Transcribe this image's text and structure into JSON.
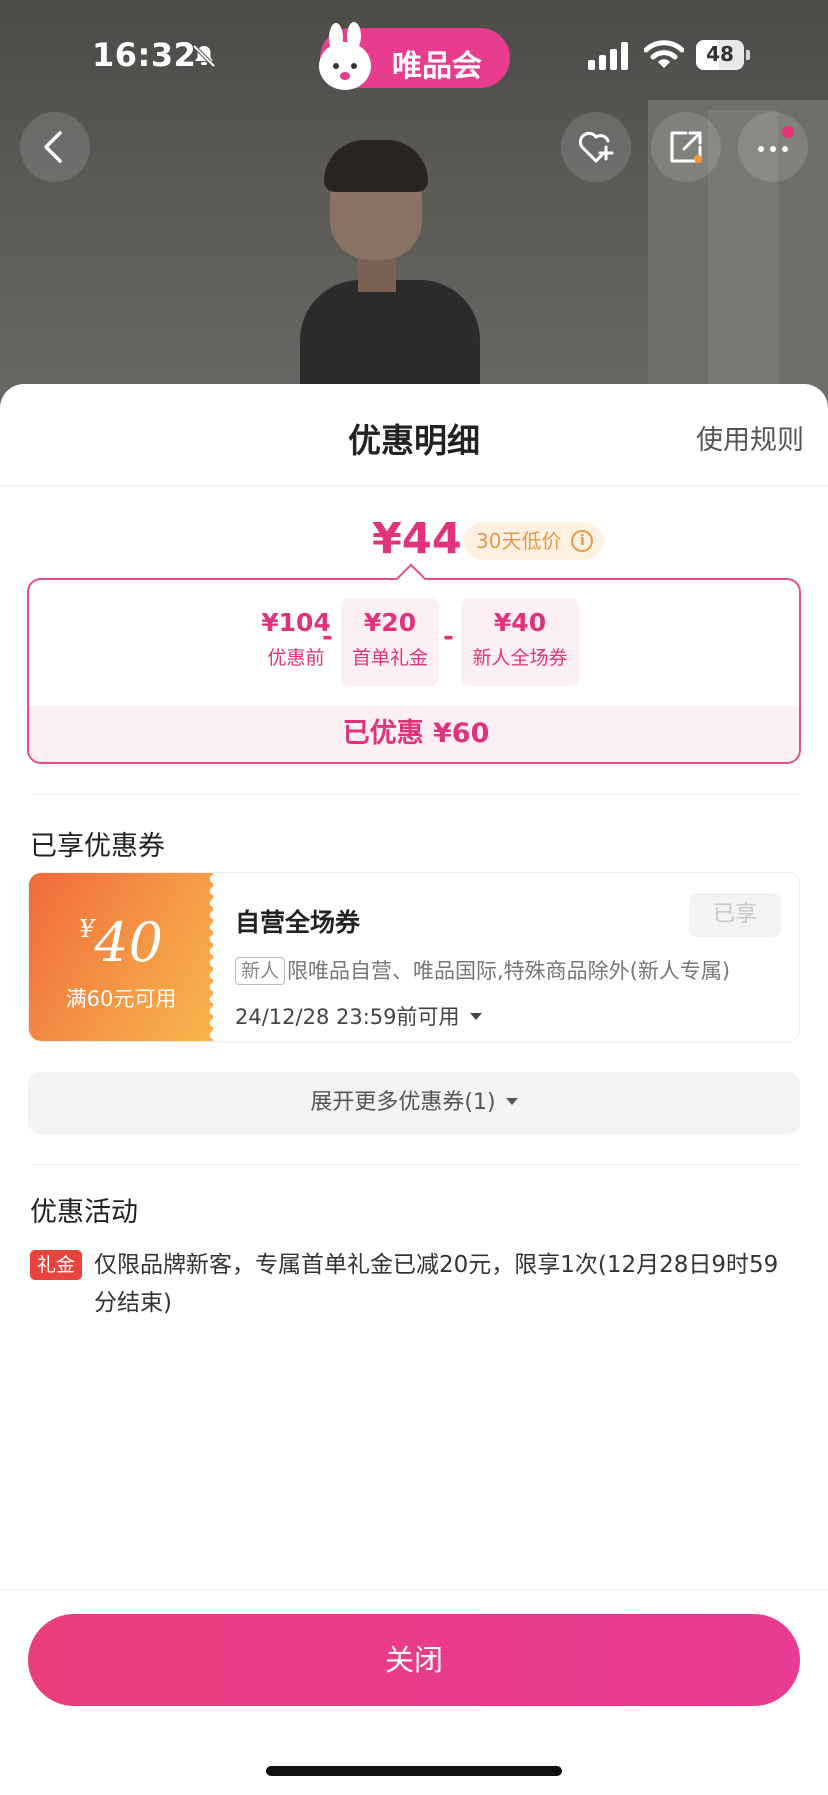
{
  "status_bar": {
    "time": "16:32",
    "battery": "48",
    "battery_level": 0.48
  },
  "app": {
    "name": "唯品会"
  },
  "sheet": {
    "title": "优惠明细",
    "rules_link": "使用规则",
    "final_price": "¥44",
    "low_price_tag": "30天低价",
    "calc": {
      "items": [
        {
          "amount": "¥104",
          "label": "优惠前"
        },
        {
          "amount": "¥20",
          "label": "首单礼金"
        },
        {
          "amount": "¥40",
          "label": "新人全场券"
        }
      ],
      "minus": "-",
      "saved": "已优惠 ¥60"
    },
    "coupons_section": {
      "title": "已享优惠券",
      "coupon": {
        "currency": "¥",
        "amount": "40",
        "condition": "满60元可用",
        "name": "自营全场券",
        "status_button": "已享",
        "tag": "新人",
        "description": "限唯品自营、唯品国际,特殊商品除外(新人专属)",
        "expire": "24/12/28 23:59前可用"
      },
      "expand_button": "展开更多优惠券(1)"
    },
    "activity_section": {
      "title": "优惠活动",
      "badge": "礼金",
      "text": "仅限品牌新客，专属首单礼金已减20元，限享1次(12月28日9时59分结束)"
    },
    "close_button": "关闭"
  },
  "colors": {
    "brand_pink": "#e0337b",
    "coupon_orange": "#f06a3c"
  }
}
